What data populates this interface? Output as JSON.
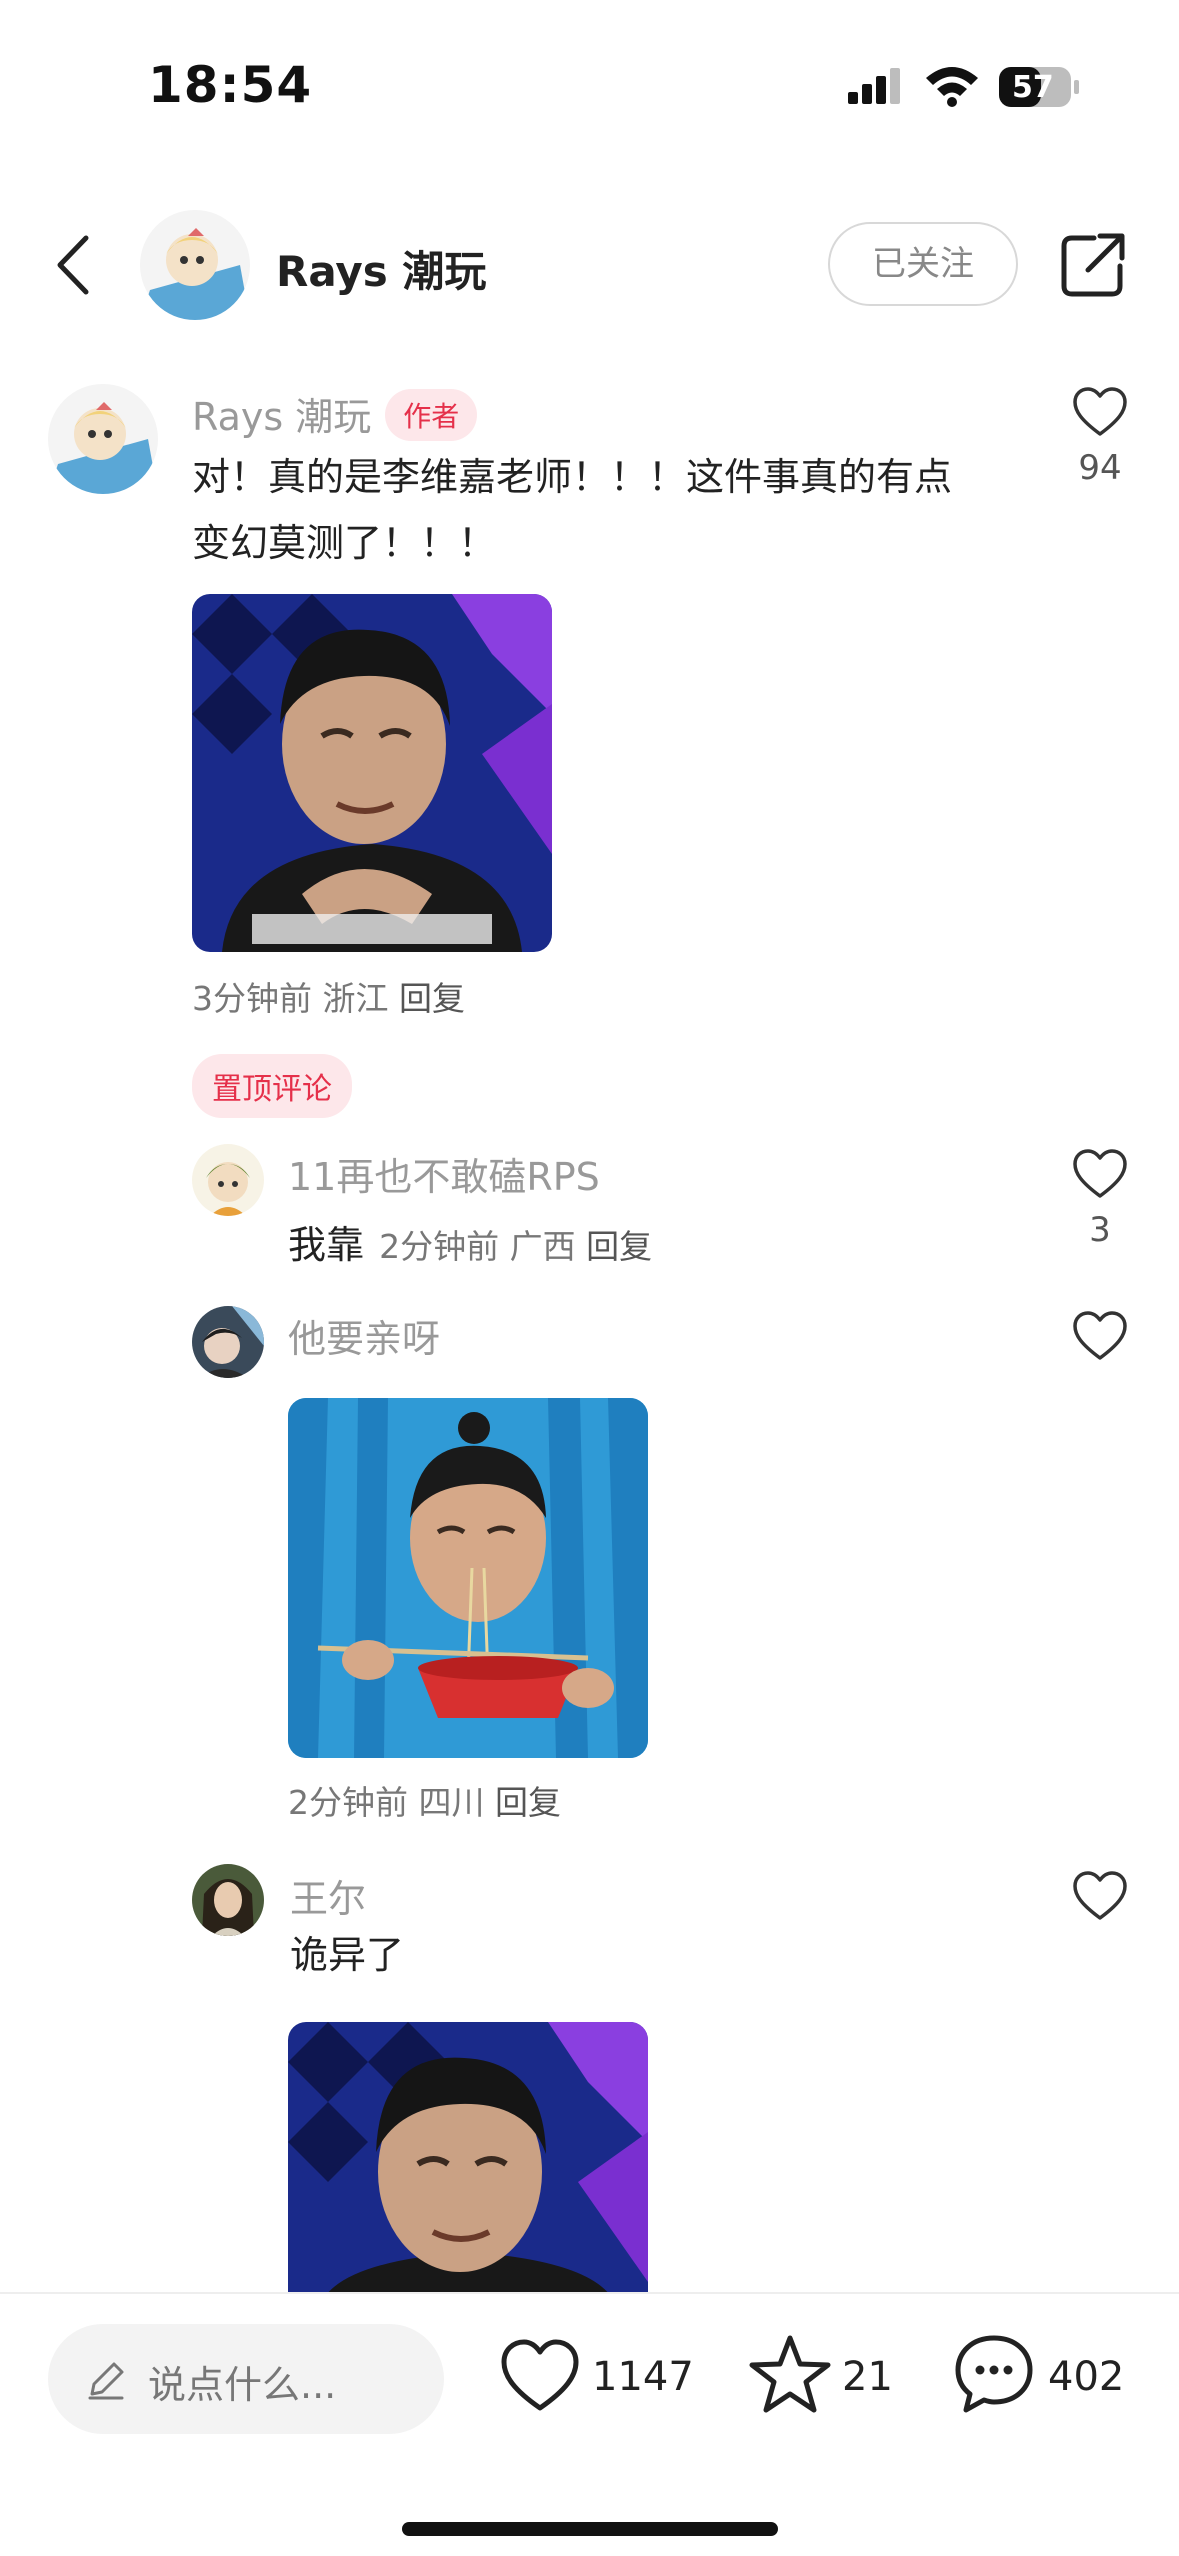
{
  "status_bar": {
    "time": "18:54",
    "battery": "57"
  },
  "header": {
    "author_name": "Rays 潮玩",
    "follow_label": "已关注"
  },
  "comments": [
    {
      "user": "Rays 潮玩",
      "badge": "作者",
      "text_line1": "对！真的是李维嘉老师！！！这件事真的有点",
      "text_line2": "变幻莫测了！！！",
      "time": "3分钟前",
      "location": "浙江",
      "reply": "回复",
      "likes": "94"
    }
  ],
  "pinned_label": "置顶评论",
  "replies": [
    {
      "user": "11再也不敢磕RPS",
      "text": "我靠",
      "time": "2分钟前",
      "location": "广西",
      "reply": "回复",
      "likes": "3"
    },
    {
      "user": "他要亲呀",
      "time": "2分钟前",
      "location": "四川",
      "reply": "回复",
      "likes": ""
    },
    {
      "user": "王尔",
      "text": "诡异了",
      "likes": ""
    }
  ],
  "bottom_bar": {
    "input_placeholder": "说点什么...",
    "likes": "1147",
    "favorites": "21",
    "comments": "402"
  },
  "icons": {
    "back": "chevron-left-icon",
    "share": "share-external-icon",
    "like": "heart-icon",
    "favorite": "star-icon",
    "comment": "chat-bubble-icon",
    "edit": "pencil-icon"
  },
  "colors": {
    "accent": "#e5304a",
    "badge_bg": "#fde7ea",
    "muted": "#999999"
  }
}
